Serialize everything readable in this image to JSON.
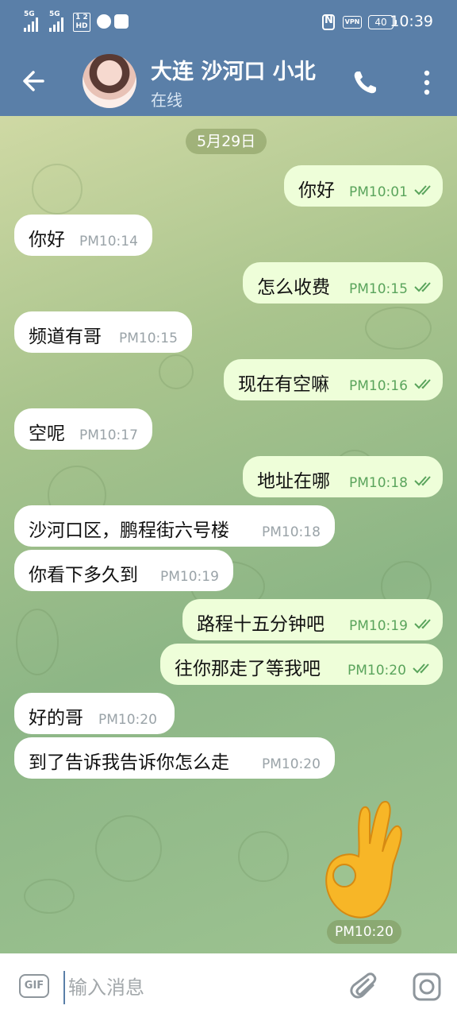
{
  "status_bar": {
    "sim1": "5G",
    "sim2": "5G",
    "hd": "1 2 HD",
    "vpn": "VPN",
    "battery": "40",
    "time": "10:39"
  },
  "header": {
    "name": "大连 沙河口 小北",
    "status": "在线"
  },
  "date_chip": "5月29日",
  "messages": [
    {
      "dir": "out",
      "text": "你好",
      "time": "PM10:01"
    },
    {
      "dir": "in",
      "text": "你好",
      "time": "PM10:14"
    },
    {
      "dir": "out",
      "text": "怎么收费",
      "time": "PM10:15"
    },
    {
      "dir": "in",
      "text": "频道有哥",
      "time": "PM10:15"
    },
    {
      "dir": "out",
      "text": "现在有空嘛",
      "time": "PM10:16"
    },
    {
      "dir": "in",
      "text": "空呢",
      "time": "PM10:17"
    },
    {
      "dir": "out",
      "text": "地址在哪",
      "time": "PM10:18"
    },
    {
      "dir": "in",
      "text": "沙河口区，鹏程街六号楼",
      "time": "PM10:18"
    },
    {
      "dir": "in",
      "text": "你看下多久到",
      "time": "PM10:19"
    },
    {
      "dir": "out",
      "text": "路程十五分钟吧",
      "time": "PM10:19"
    },
    {
      "dir": "out",
      "text": "往你那走了等我吧",
      "time": "PM10:20"
    },
    {
      "dir": "in",
      "text": "好的哥",
      "time": "PM10:20"
    },
    {
      "dir": "in",
      "text": "到了告诉我告诉你怎么走",
      "time": "PM10:20"
    }
  ],
  "sticker": {
    "icon": "ok-hand-emoji",
    "time": "PM10:20"
  },
  "input": {
    "gif_label": "GIF",
    "placeholder": "输入消息"
  },
  "colors": {
    "header": "#5a7fa8",
    "outgoing_bubble": "#eefed9",
    "incoming_bubble": "#ffffff",
    "read_ticks": "#5aa45c"
  }
}
